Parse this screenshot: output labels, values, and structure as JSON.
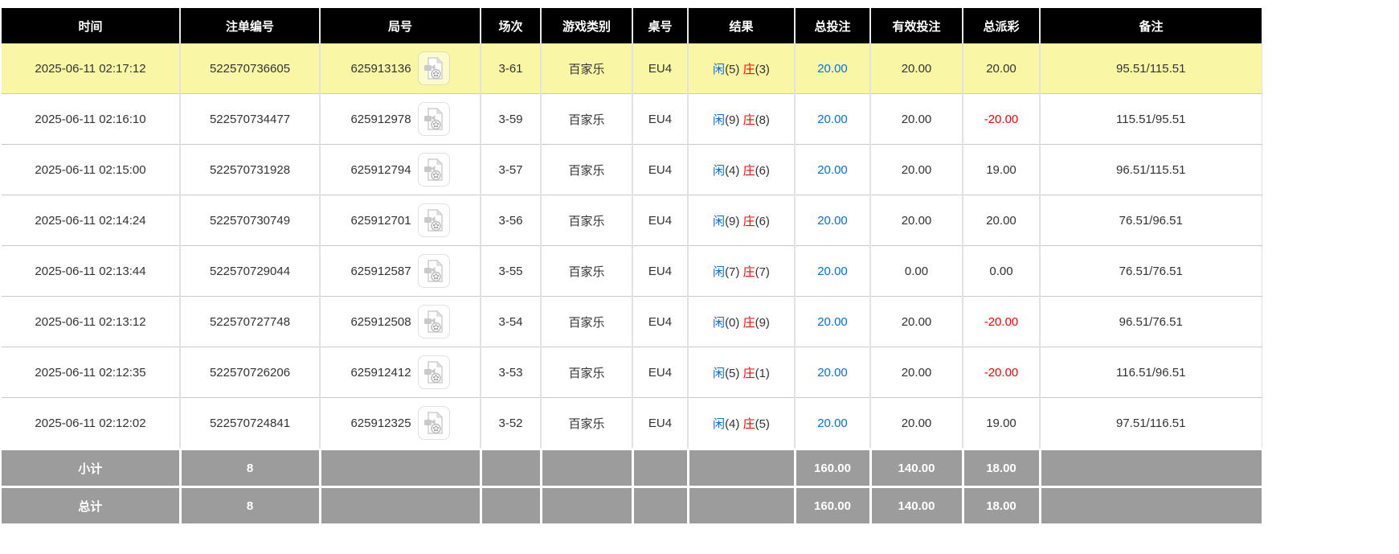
{
  "table": {
    "columns": [
      {
        "key": "time",
        "label": "时间"
      },
      {
        "key": "bet_id",
        "label": "注单编号"
      },
      {
        "key": "round",
        "label": "局号"
      },
      {
        "key": "session",
        "label": "场次"
      },
      {
        "key": "game_type",
        "label": "游戏类别"
      },
      {
        "key": "table_no",
        "label": "桌号"
      },
      {
        "key": "result",
        "label": "结果"
      },
      {
        "key": "total_bet",
        "label": "总投注"
      },
      {
        "key": "valid_bet",
        "label": "有效投注"
      },
      {
        "key": "total_payout",
        "label": "总派彩"
      },
      {
        "key": "remark",
        "label": "备注"
      }
    ],
    "result_labels": {
      "player": "闲",
      "banker": "庄"
    },
    "rows": [
      {
        "time": "2025-06-11 02:17:12",
        "bet_id": "522570736605",
        "round": "625913136",
        "session": "3-61",
        "game_type": "百家乐",
        "table_no": "EU4",
        "player_score": "(5)",
        "banker_score": "(3)",
        "total_bet": "20.00",
        "valid_bet": "20.00",
        "total_payout": "20.00",
        "remark": "95.51/115.51",
        "highlighted": true
      },
      {
        "time": "2025-06-11 02:16:10",
        "bet_id": "522570734477",
        "round": "625912978",
        "session": "3-59",
        "game_type": "百家乐",
        "table_no": "EU4",
        "player_score": "(9)",
        "banker_score": "(8)",
        "total_bet": "20.00",
        "valid_bet": "20.00",
        "total_payout": "-20.00",
        "remark": "115.51/95.51",
        "highlighted": false
      },
      {
        "time": "2025-06-11 02:15:00",
        "bet_id": "522570731928",
        "round": "625912794",
        "session": "3-57",
        "game_type": "百家乐",
        "table_no": "EU4",
        "player_score": "(4)",
        "banker_score": "(6)",
        "total_bet": "20.00",
        "valid_bet": "20.00",
        "total_payout": "19.00",
        "remark": "96.51/115.51",
        "highlighted": false
      },
      {
        "time": "2025-06-11 02:14:24",
        "bet_id": "522570730749",
        "round": "625912701",
        "session": "3-56",
        "game_type": "百家乐",
        "table_no": "EU4",
        "player_score": "(9)",
        "banker_score": "(6)",
        "total_bet": "20.00",
        "valid_bet": "20.00",
        "total_payout": "20.00",
        "remark": "76.51/96.51",
        "highlighted": false
      },
      {
        "time": "2025-06-11 02:13:44",
        "bet_id": "522570729044",
        "round": "625912587",
        "session": "3-55",
        "game_type": "百家乐",
        "table_no": "EU4",
        "player_score": "(7)",
        "banker_score": "(7)",
        "total_bet": "20.00",
        "valid_bet": "0.00",
        "total_payout": "0.00",
        "remark": "76.51/76.51",
        "highlighted": false
      },
      {
        "time": "2025-06-11 02:13:12",
        "bet_id": "522570727748",
        "round": "625912508",
        "session": "3-54",
        "game_type": "百家乐",
        "table_no": "EU4",
        "player_score": "(0)",
        "banker_score": "(9)",
        "total_bet": "20.00",
        "valid_bet": "20.00",
        "total_payout": "-20.00",
        "remark": "96.51/76.51",
        "highlighted": false
      },
      {
        "time": "2025-06-11 02:12:35",
        "bet_id": "522570726206",
        "round": "625912412",
        "session": "3-53",
        "game_type": "百家乐",
        "table_no": "EU4",
        "player_score": "(5)",
        "banker_score": "(1)",
        "total_bet": "20.00",
        "valid_bet": "20.00",
        "total_payout": "-20.00",
        "remark": "116.51/96.51",
        "highlighted": false
      },
      {
        "time": "2025-06-11 02:12:02",
        "bet_id": "522570724841",
        "round": "625912325",
        "session": "3-52",
        "game_type": "百家乐",
        "table_no": "EU4",
        "player_score": "(4)",
        "banker_score": "(5)",
        "total_bet": "20.00",
        "valid_bet": "20.00",
        "total_payout": "19.00",
        "remark": "97.51/116.51",
        "highlighted": false
      }
    ],
    "summary_rows": [
      {
        "label": "小计",
        "count": "8",
        "total_bet": "160.00",
        "valid_bet": "140.00",
        "total_payout": "18.00"
      },
      {
        "label": "总计",
        "count": "8",
        "total_bet": "160.00",
        "valid_bet": "140.00",
        "total_payout": "18.00"
      }
    ],
    "icon": "video-replay-icon"
  },
  "colors": {
    "header_bg": "#000000",
    "header_text": "#ffffff",
    "highlight_bg": "#f9f7a5",
    "summary_bg": "#9c9c9c",
    "summary_text": "#ffffff",
    "link_blue": "#0070f0",
    "banker_red": "#ff0000",
    "negative_red": "#ff0000",
    "body_text": "#333333"
  }
}
